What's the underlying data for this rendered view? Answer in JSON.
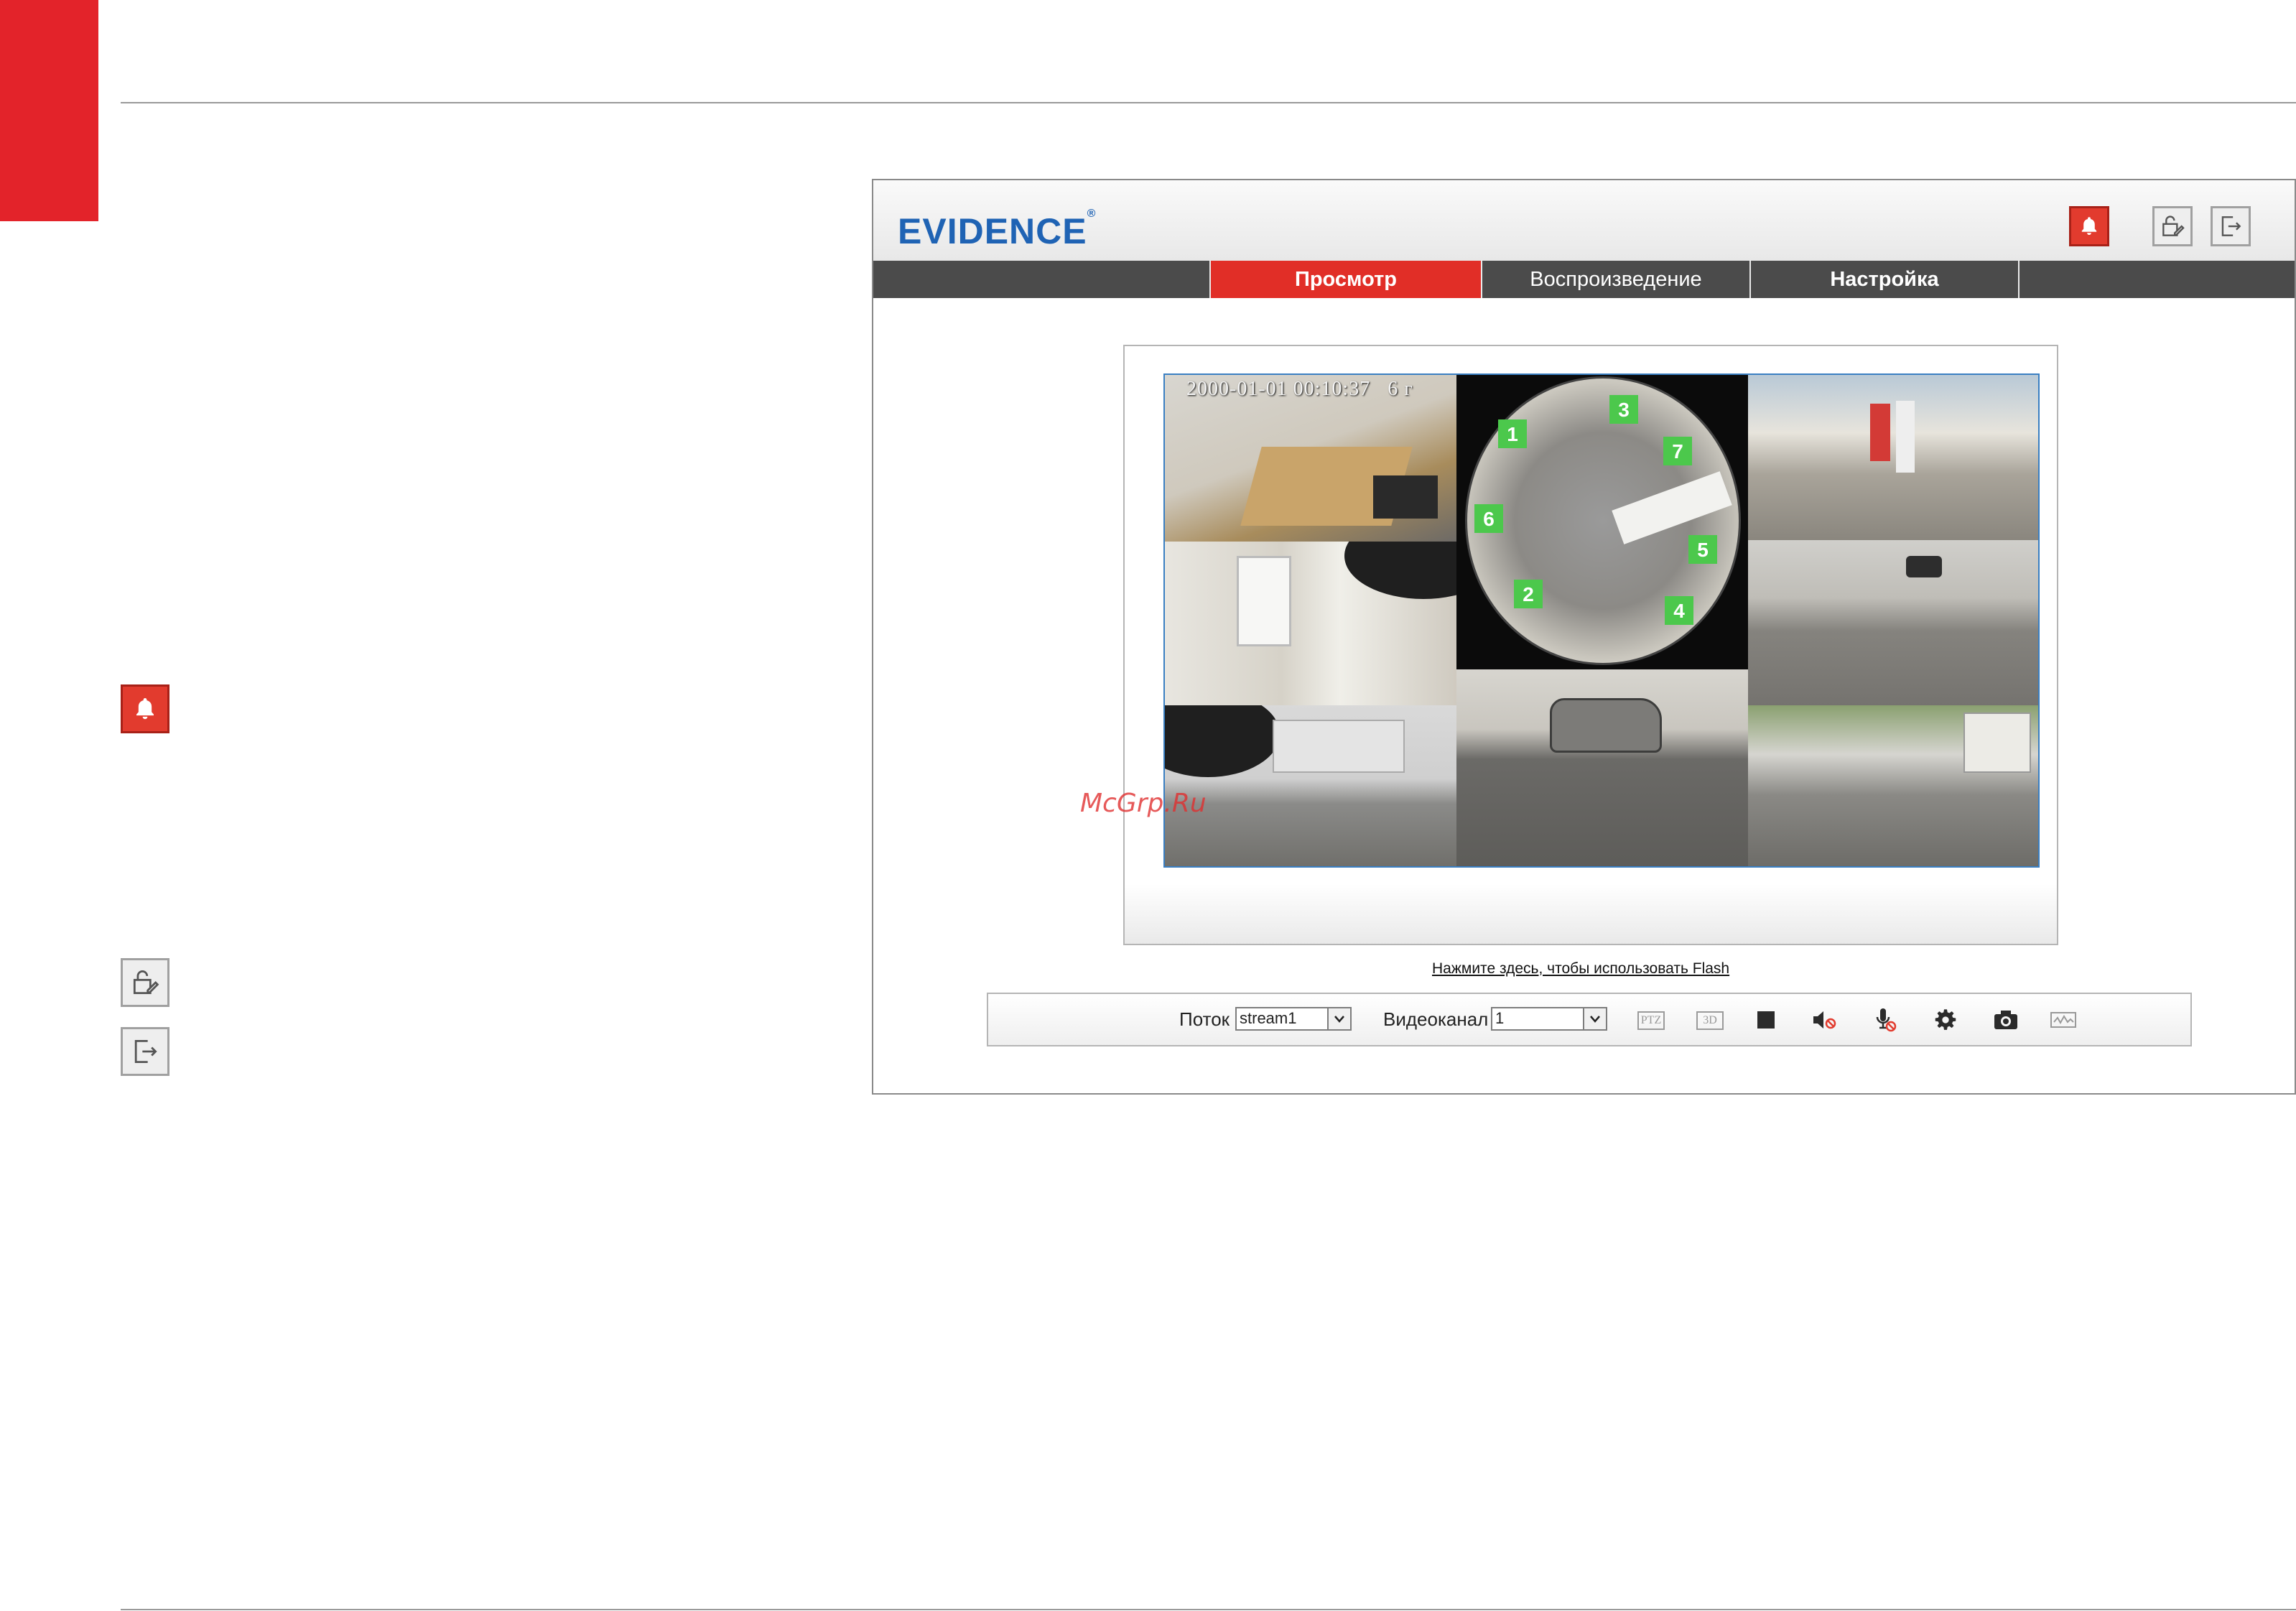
{
  "header": {
    "logo_text": "EVIDENCE",
    "logo_mark": "®"
  },
  "nav": {
    "tabs": [
      {
        "label": "Просмотр",
        "active": true
      },
      {
        "label": "Воспроизведение",
        "active": false
      },
      {
        "label": "Настройка",
        "active": false
      }
    ]
  },
  "video": {
    "osd_timestamp": "2000-01-01 00:10:37",
    "osd_suffix": "6 г",
    "fisheye_zones": [
      "1",
      "2",
      "3",
      "4",
      "5",
      "6",
      "7"
    ]
  },
  "flash_link": "Нажмите здесь, чтобы использовать Flash",
  "controls": {
    "stream_label": "Поток",
    "stream_value": "stream1",
    "channel_label": "Видеоканал",
    "channel_value": "1",
    "ptz_label": "PTZ",
    "threed_label": "3D"
  },
  "watermark": "McGrp.Ru",
  "icons": [
    "alarm-bell-icon",
    "lock-edit-icon",
    "logout-icon",
    "stop-icon",
    "mute-icon",
    "mic-off-icon",
    "settings-gear-icon",
    "snapshot-camera-icon",
    "motion-graph-icon"
  ],
  "colors": {
    "accent_red": "#e12e27",
    "logo_blue": "#1f63b4",
    "nav_gray": "#4b4b4b",
    "zone_green": "#4cc84c"
  }
}
